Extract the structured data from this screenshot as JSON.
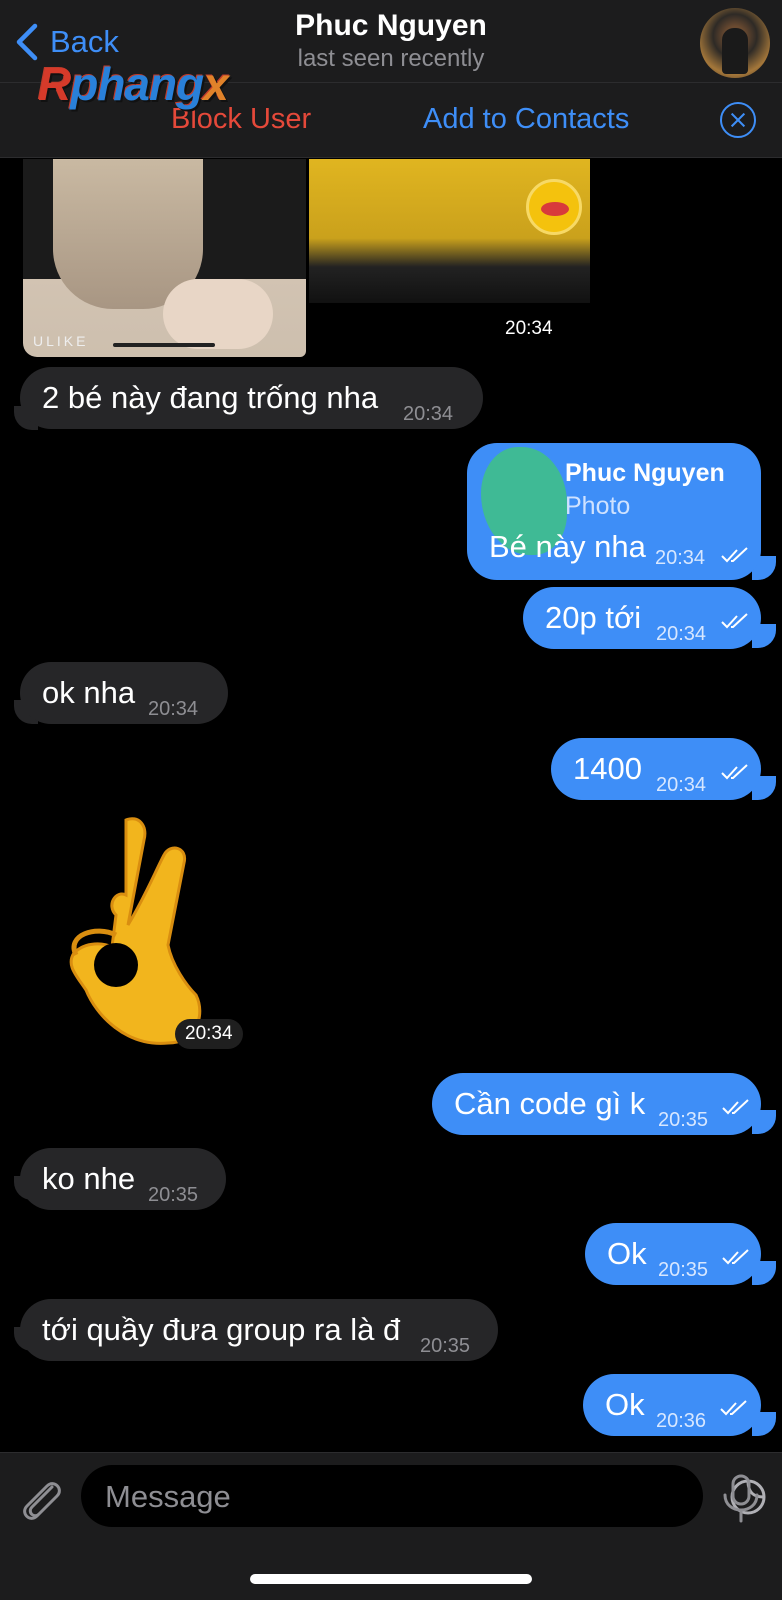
{
  "header": {
    "back_label": "Back",
    "title": "Phuc Nguyen",
    "subtitle": "last seen recently"
  },
  "watermark": {
    "part1": "R",
    "part2": "phang",
    "part3": "x"
  },
  "action_bar": {
    "block_label": "Block User",
    "add_contacts_label": "Add to Contacts"
  },
  "colors": {
    "accent": "#3e8ef7",
    "danger": "#e5493a",
    "incoming": "#262628",
    "outgoing": "#3e8ef7"
  },
  "messages": {
    "photos_time": "20:34",
    "m1": {
      "text": "2 bé này đang trống nha",
      "time": "20:34"
    },
    "reply": {
      "quoted_name": "Phuc Nguyen",
      "quoted_type": "Photo",
      "text": "Bé này nha",
      "time": "20:34"
    },
    "m3": {
      "text": "20p tới",
      "time": "20:34"
    },
    "m4": {
      "text": "ok nha",
      "time": "20:34"
    },
    "m5": {
      "text": "1400",
      "time": "20:34"
    },
    "sticker": {
      "icon": "ok-hand-sticker",
      "time": "20:34"
    },
    "m7": {
      "text": "Cần code gì k",
      "time": "20:35"
    },
    "m8": {
      "text": "ko nhe",
      "time": "20:35"
    },
    "m9": {
      "text": "Ok",
      "time": "20:35"
    },
    "m10": {
      "text": "tới quầy đưa group ra là đ",
      "time": "20:35"
    },
    "m11": {
      "text": "Ok",
      "time": "20:36"
    }
  },
  "composer": {
    "placeholder": "Message"
  }
}
